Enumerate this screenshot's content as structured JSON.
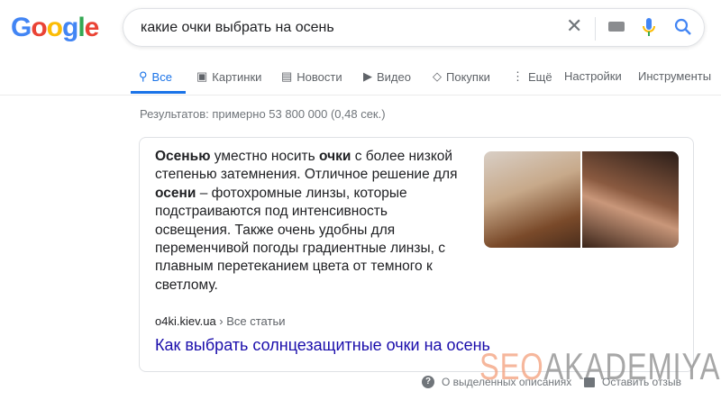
{
  "logo": {
    "text": "Google"
  },
  "search": {
    "query": "какие очки выбрать на осень",
    "icons": [
      "close-icon",
      "keyboard-icon",
      "mic-icon",
      "search-icon"
    ]
  },
  "tabs": [
    {
      "label": "Все",
      "icon": "search-icon",
      "active": true
    },
    {
      "label": "Картинки",
      "icon": "image-icon"
    },
    {
      "label": "Новости",
      "icon": "news-icon"
    },
    {
      "label": "Видео",
      "icon": "play-icon"
    },
    {
      "label": "Покупки",
      "icon": "tag-icon"
    },
    {
      "label": "Ещё",
      "icon": "more-vert-icon"
    },
    {
      "label": "Настройки"
    },
    {
      "label": "Инструменты"
    }
  ],
  "stats": "Результатов: примерно 53 800 000 (0,48 сек.)",
  "snippet": {
    "segments": [
      {
        "text": "Осенью",
        "bold": true
      },
      {
        "text": " уместно носить "
      },
      {
        "text": "очки",
        "bold": true
      },
      {
        "text": " с более низкой степенью затемнения. Отличное решение для "
      },
      {
        "text": "осени",
        "bold": true
      },
      {
        "text": " – фотохромные линзы, которые подстраиваются под интенсивность освещения. Также очень удобны для переменчивой погоды градиентные линзы, с плавным перетеканием цвета от темного к светлому."
      }
    ],
    "source_domain": "o4ki.kiev.ua",
    "source_path": " › Все статьи",
    "title": "Как выбрать солнцезащитные очки на осень"
  },
  "watermark": {
    "part1": "SEO",
    "part2": "AKADEMIYA",
    "color1": "#f4a07c",
    "color2": "#8a8a8a"
  },
  "footer": {
    "about": "О выделенных описаниях",
    "feedback": "Оставить отзыв"
  },
  "colors": {
    "accent": "#1a73e8",
    "link": "#1a0dab"
  }
}
